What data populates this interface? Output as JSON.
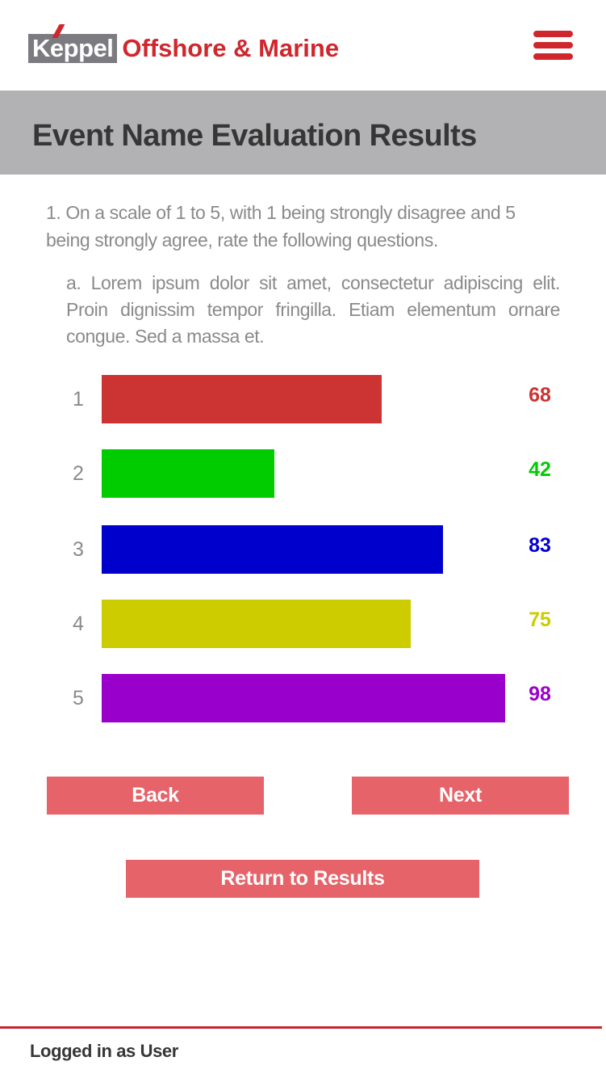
{
  "header": {
    "logo_brand": "Keppel",
    "logo_subtitle": "Offshore & Marine",
    "menu_icon": "hamburger-menu-icon"
  },
  "page": {
    "title": "Event Name Evaluation Results"
  },
  "question": {
    "text": "1. On a scale of 1 to 5, with 1 being strongly disagree and 5 being strongly agree, rate the following questions.",
    "sub_text": "a. Lorem ipsum dolor sit amet, consectetur adipiscing elit. Proin dignissim tempor fringilla. Etiam elementum ornare congue. Sed a massa et."
  },
  "chart_data": {
    "type": "bar",
    "orientation": "horizontal",
    "categories": [
      "1",
      "2",
      "3",
      "4",
      "5"
    ],
    "values": [
      68,
      42,
      83,
      75,
      98
    ],
    "colors": [
      "#cc3333",
      "#00cc00",
      "#0000cc",
      "#cccc00",
      "#9900cc"
    ],
    "xlim": [
      0,
      100
    ]
  },
  "buttons": {
    "back": "Back",
    "next": "Next",
    "return_results": "Return to Results"
  },
  "footer": {
    "status": "Logged in as User"
  },
  "colors": {
    "brand_red": "#d0262d",
    "button_bg": "#e6636a",
    "title_bar_bg": "#b2b2b4",
    "logo_grey": "#7b7b80"
  }
}
